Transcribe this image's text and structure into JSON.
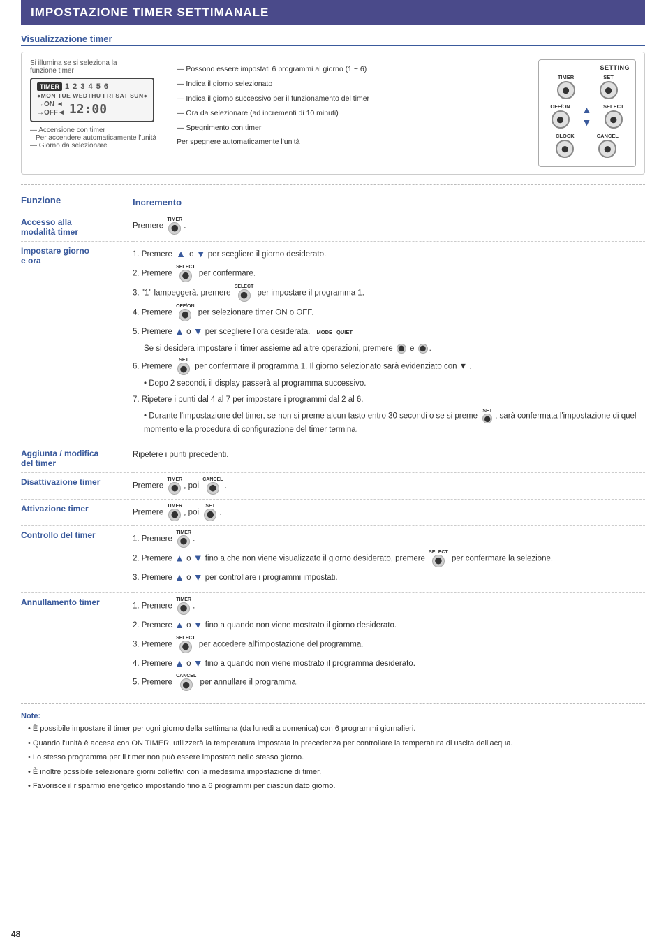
{
  "page": {
    "title": "IMPOSTAZIONE TIMER SETTIMANALE",
    "page_number": "48"
  },
  "viz_section": {
    "title": "Visualizzazione timer",
    "left_labels": [
      "Si illumina se si seleziona la",
      "funzione timer"
    ],
    "annotations": [
      "Possono essere impostati 6 programmi al giorno (1 ~ 6)",
      "Indica il giorno selezionato",
      "Indica il giorno successivo per il funzionamento del timer",
      "Ora da selezionare (ad incrementi di 10 minuti)",
      "Spegnimento con timer",
      "Per spegnere automaticamente l'unità"
    ],
    "bottom_labels": [
      "Accensione con timer",
      "Per accendere automaticamente l'unità",
      "Giorno da selezionare"
    ],
    "timer_display": {
      "label": "TIMER",
      "numbers": "1 2 3 4 5 6",
      "days": "MON TUE WEDTHU FRI SAT SUN",
      "on": "ON",
      "off": "OFF",
      "time": "12:00"
    },
    "buttons": {
      "panel_label": "SETTING",
      "timer_label": "TIMER",
      "set_label": "SET",
      "offon_label": "OFF/ON",
      "select_label": "SELECT",
      "clock_label": "CLOCK",
      "cancel_label": "CANCEL"
    }
  },
  "table": {
    "col1_header": "Funzione",
    "col2_header": "Incremento",
    "rows": [
      {
        "funzione": "Accesso alla modalità timer",
        "incremento_text": "Premere [TIMER]."
      },
      {
        "funzione": "Impostare giorno e ora",
        "steps": [
          "1. Premere [↑] o [↓] per scegliere il giorno desiderato.",
          "2. Premere [SELECT] per confermare.",
          "3. \"1\" lampeggerà, premere [SELECT] per impostare il programma 1.",
          "4. Premere [OFF/ON] per selezionare timer ON o OFF.",
          "5. Premere [↑] o [↓] per scegliere l'ora desiderata.",
          "   Se si desidera impostare il timer assieme ad altre operazioni, premere [MODE] e [QUIET].",
          "6. Premere [SET] per confermare il programma 1. Il giorno selezionato sarà evidenziato con ▼ .",
          "   • Dopo 2 secondi, il display passerà al programma successivo.",
          "7. Ripetere i punti dal 4 al 7 per impostare i programmi dal 2 al 6.",
          "   • Durante l'impostazione del timer, se non si preme alcun tasto entro 30 secondi o se si preme [SET], sarà confermata l'impostazione di quel momento e la procedura di configurazione del timer termina."
        ]
      },
      {
        "funzione": "Aggiunta / modifica del timer",
        "incremento_text": "Ripetere i punti precedenti."
      },
      {
        "funzione": "Disattivazione timer",
        "incremento_text": "Premere [TIMER], poi [CANCEL]."
      },
      {
        "funzione": "Attivazione timer",
        "incremento_text": "Premere [TIMER], poi [SET]."
      },
      {
        "funzione": "Controllo del timer",
        "steps": [
          "1. Premere [TIMER].",
          "2. Premere [↑] o [↓] fino a che non viene visualizzato il giorno desiderato, premere [SELECT] per confermare la selezione.",
          "3. Premere [↑] o [↓] per controllare i programmi impostati."
        ]
      },
      {
        "funzione": "Annullamento timer",
        "steps": [
          "1. Premere [TIMER].",
          "2. Premere [↑] o [↓] fino a quando non viene mostrato il giorno desiderato.",
          "3. Premere [SELECT] per accedere all'impostazione del programma.",
          "4. Premere [↑] o [↓] fino a quando non viene mostrato il programma desiderato.",
          "5. Premere [CANCEL] per annullare il programma."
        ]
      }
    ]
  },
  "notes": {
    "title": "Note:",
    "items": [
      "È possibile impostare il timer per ogni giorno della settimana (da lunedì a domenica) con 6 programmi giornalieri.",
      "Quando l'unità è accesa con ON TIMER, utilizzerà la temperatura impostata in precedenza per controllare la temperatura di uscita dell'acqua.",
      "Lo stesso programma per il timer non può essere impostato nello stesso giorno.",
      "È inoltre possibile selezionare giorni collettivi con la medesima impostazione di timer.",
      "Favorisce il risparmio energetico impostando fino a 6 programmi per ciascun dato giorno."
    ]
  }
}
